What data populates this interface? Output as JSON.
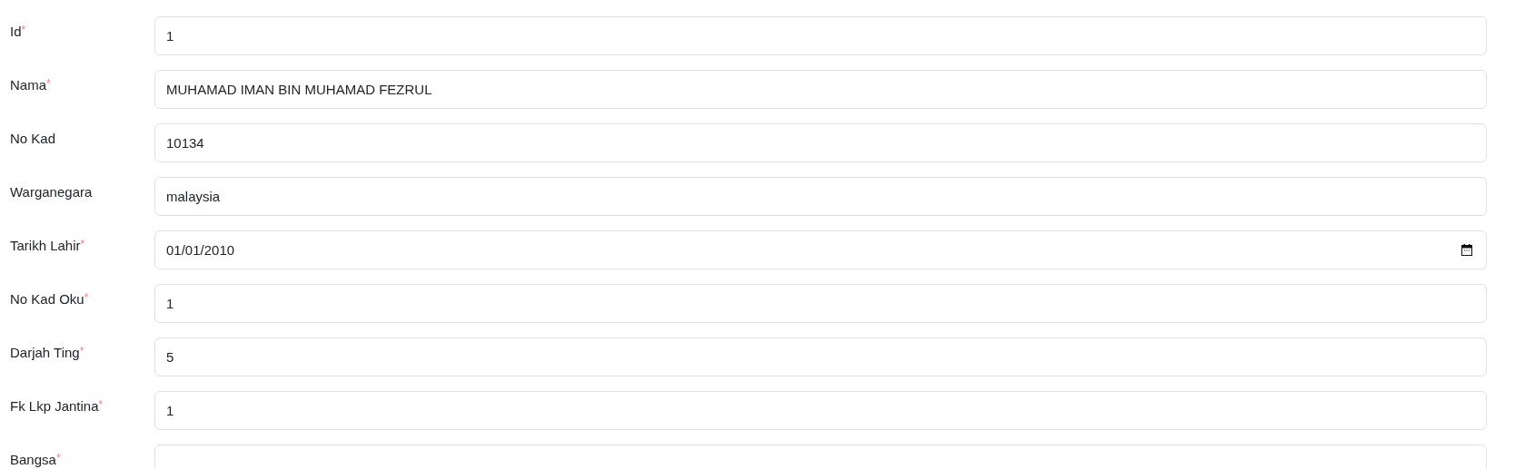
{
  "required_mark": "*",
  "fields": [
    {
      "label": "Id",
      "required": true,
      "kind": "text",
      "value": "1"
    },
    {
      "label": "Nama",
      "required": true,
      "kind": "text",
      "value": "MUHAMAD IMAN BIN MUHAMAD FEZRUL"
    },
    {
      "label": "No Kad",
      "required": false,
      "kind": "text",
      "value": "10134"
    },
    {
      "label": "Warganegara",
      "required": false,
      "kind": "text",
      "value": "malaysia"
    },
    {
      "label": "Tarikh Lahir",
      "required": true,
      "kind": "date",
      "value": "01/01/2010"
    },
    {
      "label": "No Kad Oku",
      "required": true,
      "kind": "text",
      "value": "1"
    },
    {
      "label": "Darjah Ting",
      "required": true,
      "kind": "text",
      "value": "5"
    },
    {
      "label": "Fk Lkp Jantina",
      "required": true,
      "kind": "text",
      "value": "1"
    },
    {
      "label": "Bangsa",
      "required": true,
      "kind": "text"
    }
  ]
}
